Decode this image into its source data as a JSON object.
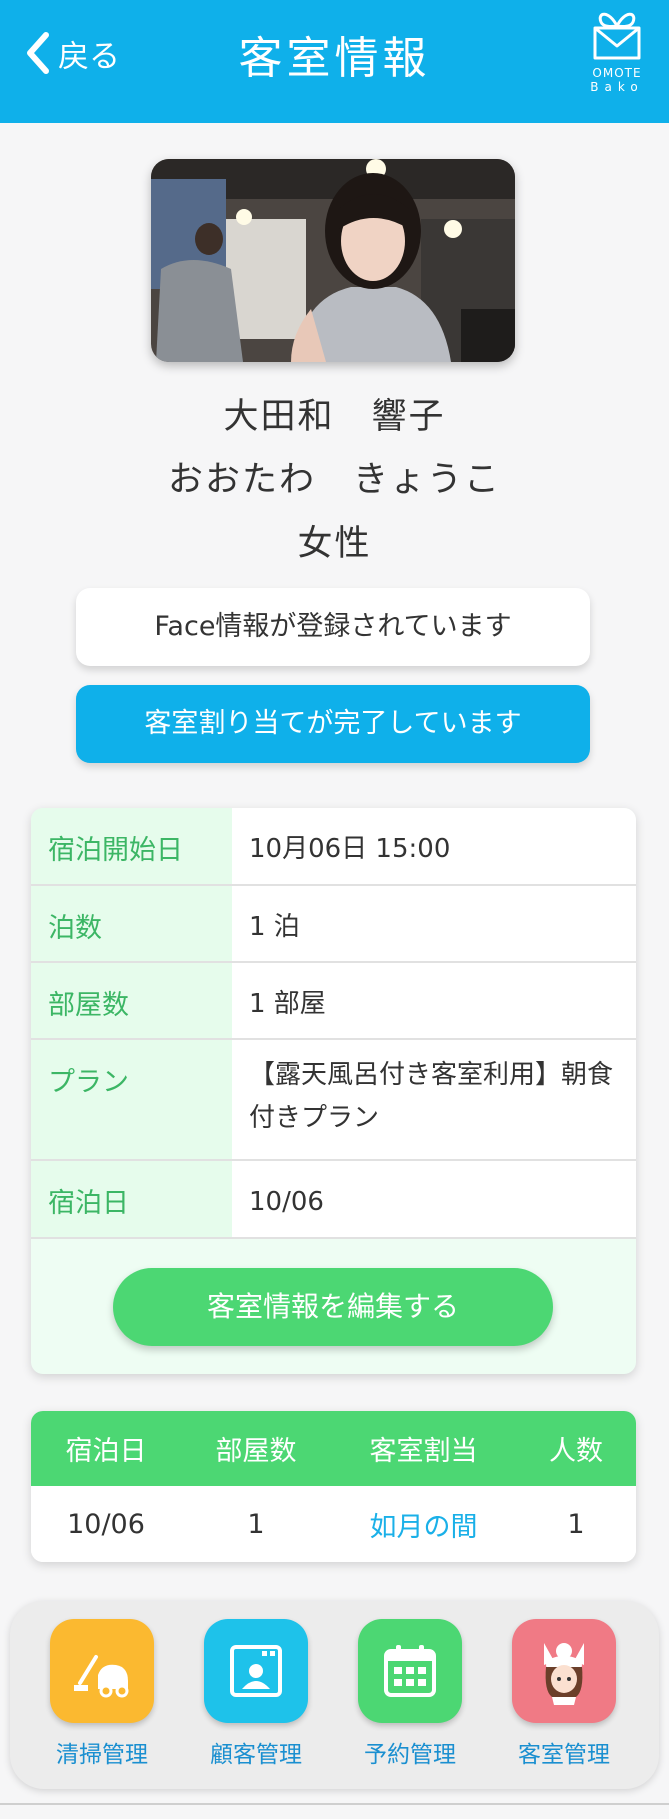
{
  "header": {
    "back_label": "戻る",
    "title": "客室情報",
    "logo_line1": "OMOTE",
    "logo_line2": "Bako",
    "background_color": "#0fb0ea"
  },
  "guest": {
    "name": "大田和　響子",
    "kana": "おおたわ　きょうこ",
    "gender": "女性"
  },
  "status": {
    "face_registered": "Face情報が登録されています",
    "room_assigned": "客室割り当てが完了しています"
  },
  "reservation": {
    "rows": [
      {
        "label": "宿泊開始日",
        "value": "10月06日 15:00"
      },
      {
        "label": "泊数",
        "value": "1 泊"
      },
      {
        "label": "部屋数",
        "value": "1 部屋"
      },
      {
        "label": "プラン",
        "value": "【露天風呂付き客室利用】朝食付きプラン"
      },
      {
        "label": "宿泊日",
        "value": "10/06"
      }
    ],
    "edit_button": "客室情報を編集する"
  },
  "stay_table": {
    "headers": [
      "宿泊日",
      "部屋数",
      "客室割当",
      "人数"
    ],
    "rows": [
      {
        "date": "10/06",
        "rooms": "1",
        "room_name": "如月の間",
        "guests": "1"
      }
    ]
  },
  "bottom_nav": [
    {
      "label": "清掃管理",
      "icon": "vacuum-cleaner-icon",
      "color": "#fbb930"
    },
    {
      "label": "顧客管理",
      "icon": "customer-card-icon",
      "color": "#1ec2ea"
    },
    {
      "label": "予約管理",
      "icon": "calendar-icon",
      "color": "#4cd773"
    },
    {
      "label": "客室管理",
      "icon": "maid-character-icon",
      "color": "#f07a85"
    }
  ],
  "colors": {
    "accent_green": "#4cd773",
    "label_green": "#3cb665",
    "link_blue": "#1ab0e8"
  }
}
